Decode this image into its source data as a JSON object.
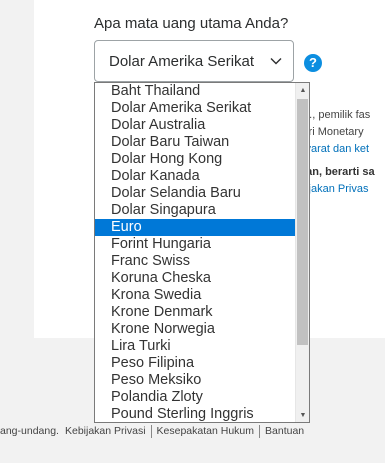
{
  "question": "Apa mata uang utama Anda?",
  "select": {
    "value": "Dolar Amerika Serikat",
    "icon": "chevron-down-icon"
  },
  "help": {
    "label": "?",
    "icon": "help-icon"
  },
  "side": {
    "line1": "td., pemilik fas",
    "line2": "lari Monetary",
    "line3": "syarat dan ket",
    "line4": "kan, berarti sa",
    "line5": "bijakan Privas"
  },
  "options": [
    "Baht Thailand",
    "Dolar Amerika Serikat",
    "Dolar Australia",
    "Dolar Baru Taiwan",
    "Dolar Hong Kong",
    "Dolar Kanada",
    "Dolar Selandia Baru",
    "Dolar Singapura",
    "Euro",
    "Forint Hungaria",
    "Franc Swiss",
    "Koruna Cheska",
    "Krona Swedia",
    "Krone Denmark",
    "Krone Norwegia",
    "Lira Turki",
    "Peso Filipina",
    "Peso Meksiko",
    "Polandia Zloty",
    "Pound Sterling Inggris"
  ],
  "selected_index": 8,
  "scroll": {
    "up": "▲",
    "down": "▼"
  },
  "footer": {
    "item0": "ang-undang.",
    "item1": "Kebijakan Privasi",
    "item2": "Kesepakatan Hukum",
    "item3": "Bantuan"
  },
  "colors": {
    "accent": "#0078d7",
    "help": "#0c8ee0",
    "link": "#0070ba"
  }
}
